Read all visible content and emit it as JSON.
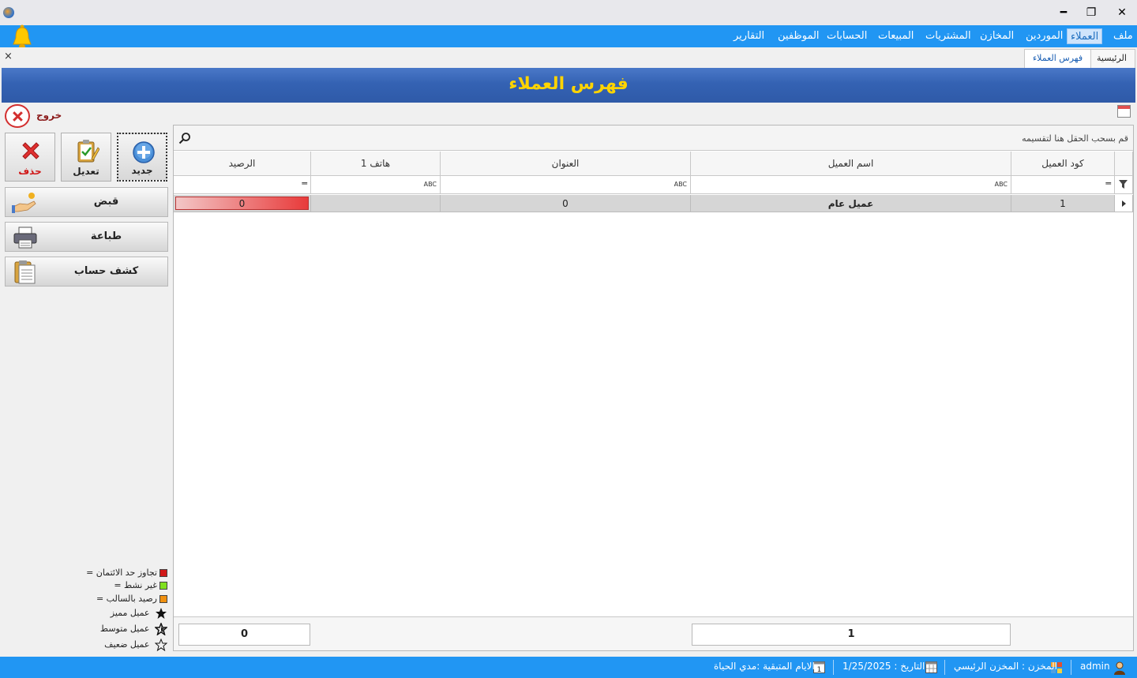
{
  "window": {
    "minimize": "━",
    "restore": "❐",
    "close": "✕"
  },
  "menu": {
    "items": [
      {
        "label": "ملف"
      },
      {
        "label": "العملاء"
      },
      {
        "label": "الموردين"
      },
      {
        "label": "المخازن"
      },
      {
        "label": "المشتريات"
      },
      {
        "label": "المبيعات"
      },
      {
        "label": "الحسابات"
      },
      {
        "label": "الموظفين"
      },
      {
        "label": "التقارير"
      }
    ],
    "active_index": 1
  },
  "tabs": {
    "items": [
      {
        "label": "الرئيسية"
      },
      {
        "label": "فهرس العملاء"
      }
    ],
    "close_label": "×"
  },
  "header": {
    "title": "فهرس العملاء"
  },
  "actions": {
    "exit_label": "خروج",
    "new_label": "جديد",
    "edit_label": "تعديل",
    "delete_label": "حذف",
    "receipt_label": "قبض",
    "print_label": "طباعة",
    "statement_label": "كشف حساب"
  },
  "grid": {
    "group_hint": "قم بسحب الحقل هنا لتقسيمه",
    "columns": [
      {
        "label": "كود العميل"
      },
      {
        "label": "اسم العميل"
      },
      {
        "label": "العنوان"
      },
      {
        "label": "هاتف 1"
      },
      {
        "label": "الرصيد"
      }
    ],
    "rows": [
      {
        "code": "1",
        "name": "عميل عام",
        "address": "0",
        "phone": "",
        "balance": "0"
      }
    ],
    "footer": {
      "count": "1",
      "balance_total": "0"
    }
  },
  "legend": {
    "items": [
      {
        "label": "= تجاوز حد الائتمان",
        "color": "#d01818"
      },
      {
        "label": "= غير نشط",
        "color": "#80e020"
      },
      {
        "label": "= رصيد بالسالب",
        "color": "#f09010"
      },
      {
        "label": "عميل مميز",
        "icon": "star-filled-icon"
      },
      {
        "label": "عميل متوسط",
        "icon": "star-half-icon"
      },
      {
        "label": "عميل ضعيف",
        "icon": "star-empty-icon"
      }
    ]
  },
  "status": {
    "user": "admin",
    "store": "المخزن : المخزن الرئيسي",
    "date": "التاريخ : 1/25/2025",
    "days_left": "الايام المتبقية :مدي الحياة"
  },
  "colors": {
    "menubar": "#2196f3",
    "banner": "#3462b3",
    "title_text": "#ffd400",
    "balance_negative": "#e83a3a"
  }
}
